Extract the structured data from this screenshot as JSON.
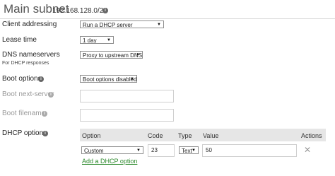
{
  "header": {
    "title": "Main subnet",
    "subnet": "192.168.128.0/24"
  },
  "fields": {
    "client_addressing": {
      "label": "Client addressing",
      "value": "Run a DHCP server"
    },
    "lease_time": {
      "label": "Lease time",
      "value": "1 day"
    },
    "dns_nameservers": {
      "label": "DNS nameservers",
      "sublabel": "For DHCP responses",
      "value": "Proxy to upstream DNS"
    },
    "boot_options": {
      "label": "Boot options",
      "value": "Boot options disabled"
    },
    "boot_next_server": {
      "label": "Boot next-server",
      "value": ""
    },
    "boot_filename": {
      "label": "Boot filename",
      "value": ""
    }
  },
  "dhcp_options": {
    "label": "DHCP options",
    "columns": {
      "option": "Option",
      "code": "Code",
      "type": "Type",
      "value": "Value",
      "actions": "Actions"
    },
    "rows": [
      {
        "option": "Custom",
        "code": "23",
        "type": "Text",
        "value": "50"
      }
    ],
    "add_link": "Add a DHCP option"
  },
  "icons": {
    "info": "info-icon",
    "dropdown": "chevron-down-icon",
    "delete": "close-icon"
  }
}
